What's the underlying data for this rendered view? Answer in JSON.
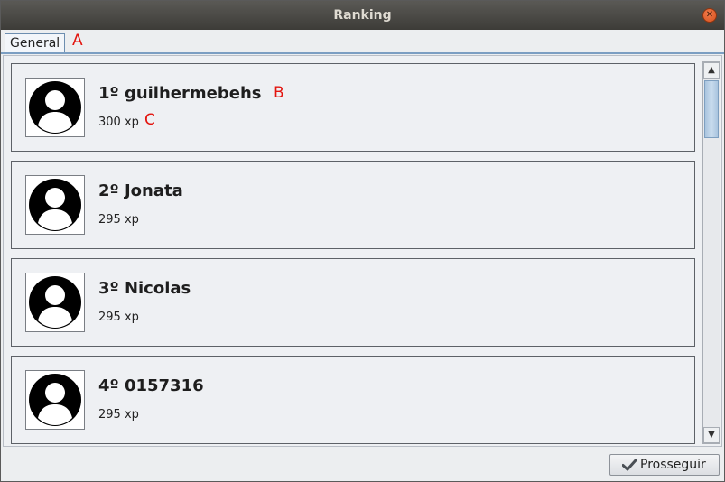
{
  "window": {
    "title": "Ranking"
  },
  "tabs": [
    {
      "label": "General"
    }
  ],
  "annotations": {
    "a": "A",
    "b": "B",
    "c": "C"
  },
  "ranking": [
    {
      "name": "1º guilhermebehs",
      "xp": "300 xp"
    },
    {
      "name": "2º Jonata",
      "xp": "295 xp"
    },
    {
      "name": "3º Nicolas",
      "xp": "295 xp"
    },
    {
      "name": "4º 0157316",
      "xp": "295 xp"
    }
  ],
  "footer": {
    "proceed_label": "Prosseguir"
  },
  "icons": {
    "close": "close-icon",
    "avatar": "user-avatar-icon",
    "check": "check-icon",
    "scroll_up": "arrow-up-icon",
    "scroll_down": "arrow-down-icon"
  },
  "colors": {
    "tab_border": "#6d8eb0",
    "accent": "#7b9ec2",
    "close": "#e05a25",
    "marker": "#e3140e"
  }
}
